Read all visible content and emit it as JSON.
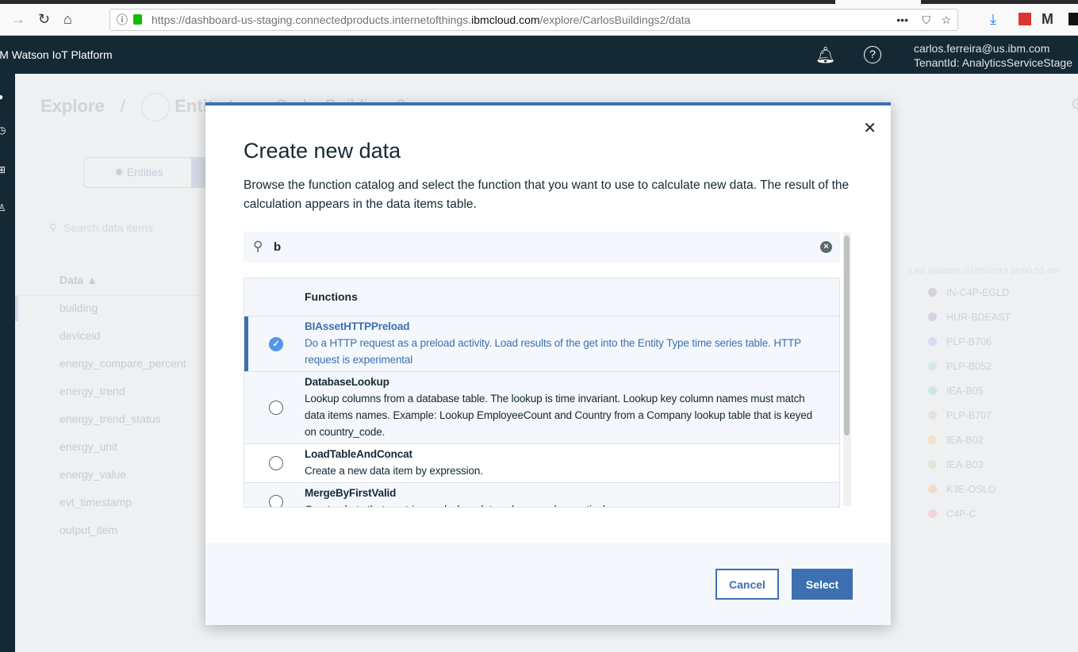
{
  "browser": {
    "url_prefix": "https://dashboard-us-staging.connectedproducts.internetofthings.",
    "url_domain": "ibmcloud.com",
    "url_path": "/explore/CarlosBuildings2/data"
  },
  "app": {
    "brand": "IBM  Watson IoT Platform",
    "user_email": "carlos.ferreira@us.ibm.com",
    "tenant": "TenantId: AnalyticsServiceStage"
  },
  "background": {
    "breadcrumb_root": "Explore",
    "breadcrumb_sep": "/",
    "entity_label": "Entity type:",
    "entity_name": "CarlosBuildings2",
    "entities_tab": "Entities",
    "search_placeholder": "Search data items",
    "data_header": "Data ▲",
    "data_items": [
      "building",
      "deviceid",
      "energy_compare_percent",
      "energy_trend",
      "energy_trend_status",
      "energy_unit",
      "energy_value",
      "evt_timestamp",
      "output_item"
    ],
    "last_updated": "Last updated: 07/05/2019 10:00:52 am",
    "legend": [
      {
        "label": "IN-C4P-EGLD",
        "color": "#d6d2d6"
      },
      {
        "label": "HUR-BDEAST",
        "color": "#d6d4e4"
      },
      {
        "label": "PLP-B706",
        "color": "#d4dcf0"
      },
      {
        "label": "PLP-B052",
        "color": "#d3ebe6"
      },
      {
        "label": "IEA-B05",
        "color": "#cfe6e3"
      },
      {
        "label": "PLP-B707",
        "color": "#e2e2e2"
      },
      {
        "label": "IEA-B02",
        "color": "#f2e3c8"
      },
      {
        "label": "IEA-B03",
        "color": "#dde9d4"
      },
      {
        "label": "K3E-OSLO",
        "color": "#f2dcc6"
      },
      {
        "label": "C4P-C",
        "color": "#f2d4de"
      }
    ]
  },
  "modal": {
    "title": "Create new data",
    "description": "Browse the function catalog and select the function that you want to use to calculate new data. The result of the calculation appears in the data items table.",
    "search_value": "b",
    "column_header": "Functions",
    "functions": [
      {
        "name": "BIAssetHTTPPreload",
        "description": "Do a HTTP request as a preload activity. Load results of the get into the Entity Type time series table. HTTP request is experimental",
        "selected": true
      },
      {
        "name": "DatabaseLookup",
        "description": "Lookup columns from a database table. The lookup is time invariant. Lookup key column names must match data items names. Example: Lookup EmployeeCount and Country from a Company lookup table that is keyed on country_code.",
        "selected": false
      },
      {
        "name": "LoadTableAndConcat",
        "description": "Create a new data item by expression.",
        "selected": false
      },
      {
        "name": "MergeByFirstValid",
        "description": "Create alerts that are triggered when data values reach a particular range.",
        "selected": false
      }
    ],
    "cancel_label": "Cancel",
    "select_label": "Select",
    "accent": "#3d70b2"
  }
}
